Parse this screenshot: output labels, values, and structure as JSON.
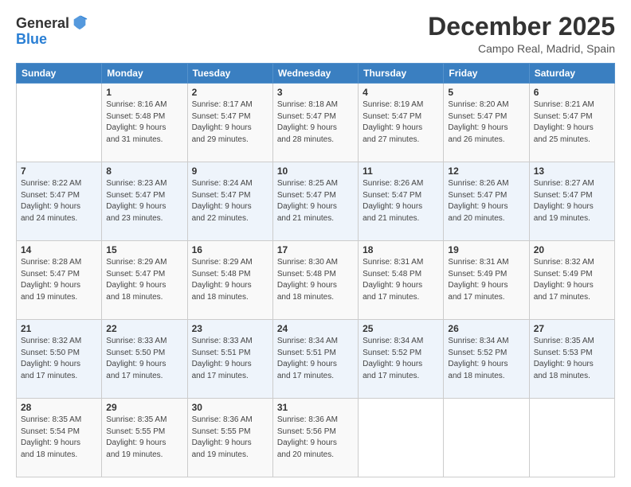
{
  "logo": {
    "general": "General",
    "blue": "Blue"
  },
  "header": {
    "month": "December 2025",
    "location": "Campo Real, Madrid, Spain"
  },
  "weekdays": [
    "Sunday",
    "Monday",
    "Tuesday",
    "Wednesday",
    "Thursday",
    "Friday",
    "Saturday"
  ],
  "weeks": [
    [
      {
        "day": "",
        "info": ""
      },
      {
        "day": "1",
        "info": "Sunrise: 8:16 AM\nSunset: 5:48 PM\nDaylight: 9 hours\nand 31 minutes."
      },
      {
        "day": "2",
        "info": "Sunrise: 8:17 AM\nSunset: 5:47 PM\nDaylight: 9 hours\nand 29 minutes."
      },
      {
        "day": "3",
        "info": "Sunrise: 8:18 AM\nSunset: 5:47 PM\nDaylight: 9 hours\nand 28 minutes."
      },
      {
        "day": "4",
        "info": "Sunrise: 8:19 AM\nSunset: 5:47 PM\nDaylight: 9 hours\nand 27 minutes."
      },
      {
        "day": "5",
        "info": "Sunrise: 8:20 AM\nSunset: 5:47 PM\nDaylight: 9 hours\nand 26 minutes."
      },
      {
        "day": "6",
        "info": "Sunrise: 8:21 AM\nSunset: 5:47 PM\nDaylight: 9 hours\nand 25 minutes."
      }
    ],
    [
      {
        "day": "7",
        "info": "Sunrise: 8:22 AM\nSunset: 5:47 PM\nDaylight: 9 hours\nand 24 minutes."
      },
      {
        "day": "8",
        "info": "Sunrise: 8:23 AM\nSunset: 5:47 PM\nDaylight: 9 hours\nand 23 minutes."
      },
      {
        "day": "9",
        "info": "Sunrise: 8:24 AM\nSunset: 5:47 PM\nDaylight: 9 hours\nand 22 minutes."
      },
      {
        "day": "10",
        "info": "Sunrise: 8:25 AM\nSunset: 5:47 PM\nDaylight: 9 hours\nand 21 minutes."
      },
      {
        "day": "11",
        "info": "Sunrise: 8:26 AM\nSunset: 5:47 PM\nDaylight: 9 hours\nand 21 minutes."
      },
      {
        "day": "12",
        "info": "Sunrise: 8:26 AM\nSunset: 5:47 PM\nDaylight: 9 hours\nand 20 minutes."
      },
      {
        "day": "13",
        "info": "Sunrise: 8:27 AM\nSunset: 5:47 PM\nDaylight: 9 hours\nand 19 minutes."
      }
    ],
    [
      {
        "day": "14",
        "info": "Sunrise: 8:28 AM\nSunset: 5:47 PM\nDaylight: 9 hours\nand 19 minutes."
      },
      {
        "day": "15",
        "info": "Sunrise: 8:29 AM\nSunset: 5:47 PM\nDaylight: 9 hours\nand 18 minutes."
      },
      {
        "day": "16",
        "info": "Sunrise: 8:29 AM\nSunset: 5:48 PM\nDaylight: 9 hours\nand 18 minutes."
      },
      {
        "day": "17",
        "info": "Sunrise: 8:30 AM\nSunset: 5:48 PM\nDaylight: 9 hours\nand 18 minutes."
      },
      {
        "day": "18",
        "info": "Sunrise: 8:31 AM\nSunset: 5:48 PM\nDaylight: 9 hours\nand 17 minutes."
      },
      {
        "day": "19",
        "info": "Sunrise: 8:31 AM\nSunset: 5:49 PM\nDaylight: 9 hours\nand 17 minutes."
      },
      {
        "day": "20",
        "info": "Sunrise: 8:32 AM\nSunset: 5:49 PM\nDaylight: 9 hours\nand 17 minutes."
      }
    ],
    [
      {
        "day": "21",
        "info": "Sunrise: 8:32 AM\nSunset: 5:50 PM\nDaylight: 9 hours\nand 17 minutes."
      },
      {
        "day": "22",
        "info": "Sunrise: 8:33 AM\nSunset: 5:50 PM\nDaylight: 9 hours\nand 17 minutes."
      },
      {
        "day": "23",
        "info": "Sunrise: 8:33 AM\nSunset: 5:51 PM\nDaylight: 9 hours\nand 17 minutes."
      },
      {
        "day": "24",
        "info": "Sunrise: 8:34 AM\nSunset: 5:51 PM\nDaylight: 9 hours\nand 17 minutes."
      },
      {
        "day": "25",
        "info": "Sunrise: 8:34 AM\nSunset: 5:52 PM\nDaylight: 9 hours\nand 17 minutes."
      },
      {
        "day": "26",
        "info": "Sunrise: 8:34 AM\nSunset: 5:52 PM\nDaylight: 9 hours\nand 18 minutes."
      },
      {
        "day": "27",
        "info": "Sunrise: 8:35 AM\nSunset: 5:53 PM\nDaylight: 9 hours\nand 18 minutes."
      }
    ],
    [
      {
        "day": "28",
        "info": "Sunrise: 8:35 AM\nSunset: 5:54 PM\nDaylight: 9 hours\nand 18 minutes."
      },
      {
        "day": "29",
        "info": "Sunrise: 8:35 AM\nSunset: 5:55 PM\nDaylight: 9 hours\nand 19 minutes."
      },
      {
        "day": "30",
        "info": "Sunrise: 8:36 AM\nSunset: 5:55 PM\nDaylight: 9 hours\nand 19 minutes."
      },
      {
        "day": "31",
        "info": "Sunrise: 8:36 AM\nSunset: 5:56 PM\nDaylight: 9 hours\nand 20 minutes."
      },
      {
        "day": "",
        "info": ""
      },
      {
        "day": "",
        "info": ""
      },
      {
        "day": "",
        "info": ""
      }
    ]
  ]
}
